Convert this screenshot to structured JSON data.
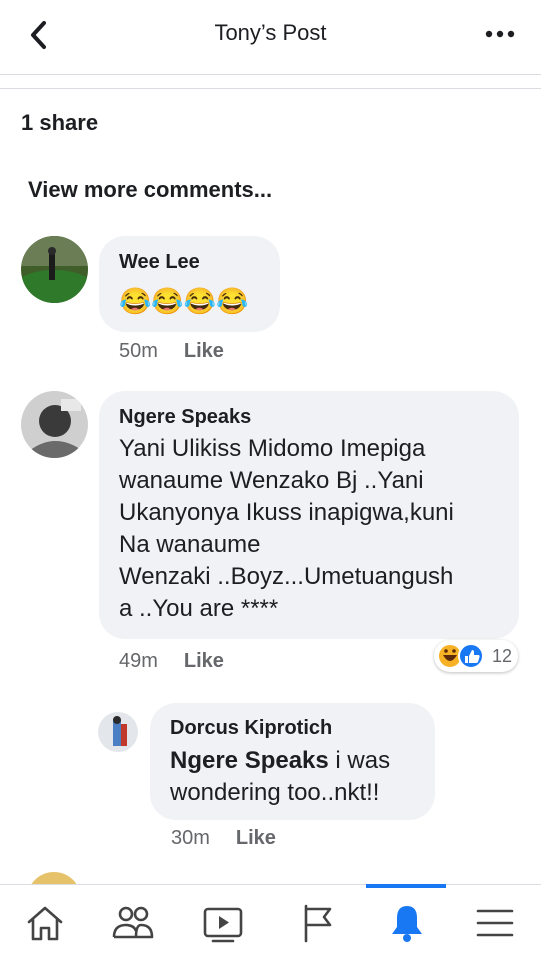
{
  "header": {
    "title": "Tony’s Post",
    "back_icon": "chevron-left-icon",
    "more_icon": "more-horizontal-icon"
  },
  "post": {
    "shares": "1 share",
    "view_more": "View more comments..."
  },
  "comments": [
    {
      "author": "Wee Lee",
      "text": "😂😂😂😂",
      "time": "50m",
      "like": "Like"
    },
    {
      "author": "Ngere Speaks",
      "lines": [
        "Yani Ulikiss Midomo Imepiga",
        "wanaume Wenzako Bj ..Yani",
        "Ukanyonya Ikuss inapigwa,kuni",
        "Na wanaume",
        "Wenzaki ..Boyz...Umetuangush",
        "a ..You are ****"
      ],
      "time": "49m",
      "like": "Like",
      "reaction_count": "12"
    },
    {
      "author": "Dorcus Kiprotich",
      "mention": "Ngere Speaks",
      "line1_rest": " i was",
      "line2": "wondering too..nkt!!",
      "time": "30m",
      "like": "Like"
    }
  ],
  "nav": [
    "home-icon",
    "friends-icon",
    "watch-icon",
    "pages-icon",
    "notifications-icon",
    "menu-icon"
  ],
  "colors": {
    "accent": "#1877f2",
    "bubble": "#f0f2f5",
    "meta": "#65676b"
  }
}
